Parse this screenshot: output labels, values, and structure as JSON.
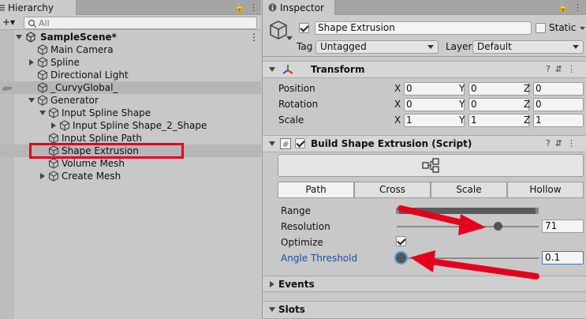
{
  "hierarchy": {
    "tab_label": "Hierarchy",
    "add_label": "+▾",
    "search_placeholder": "All",
    "items": [
      {
        "label": "SampleScene*"
      },
      {
        "label": "Main Camera"
      },
      {
        "label": "Spline"
      },
      {
        "label": "Directional Light"
      },
      {
        "label": "_CurvyGlobal_"
      },
      {
        "label": "Generator"
      },
      {
        "label": "Input Spline Shape"
      },
      {
        "label": "Input Spline Shape_2_Shape"
      },
      {
        "label": "Input Spline Path"
      },
      {
        "label": "Shape Extrusion"
      },
      {
        "label": "Volume Mesh"
      },
      {
        "label": "Create Mesh"
      }
    ]
  },
  "inspector": {
    "tab_label": "Inspector",
    "object_name": "Shape Extrusion",
    "static_label": "Static",
    "tag_label": "Tag",
    "tag_value": "Untagged",
    "layer_label": "Layer",
    "layer_value": "Default",
    "transform": {
      "title": "Transform",
      "rows": [
        {
          "label": "Position",
          "x": "0",
          "y": "0",
          "z": "0"
        },
        {
          "label": "Rotation",
          "x": "0",
          "y": "0",
          "z": "0"
        },
        {
          "label": "Scale",
          "x": "1",
          "y": "1",
          "z": "1"
        }
      ],
      "axis_x": "X",
      "axis_y": "Y",
      "axis_z": "Z"
    },
    "script": {
      "title": "Build Shape Extrusion (Script)",
      "tabs": [
        "Path",
        "Cross",
        "Scale",
        "Hollow"
      ],
      "range_label": "Range",
      "resolution_label": "Resolution",
      "resolution_value": "71",
      "resolution_level": 0.71,
      "optimize_label": "Optimize",
      "angle_label": "Angle Threshold",
      "angle_value": "0.1"
    },
    "events_label": "Events",
    "slots_label": "Slots"
  },
  "colors": {
    "annotation_red": "#e5001c",
    "link_blue": "#1a4f9c"
  }
}
